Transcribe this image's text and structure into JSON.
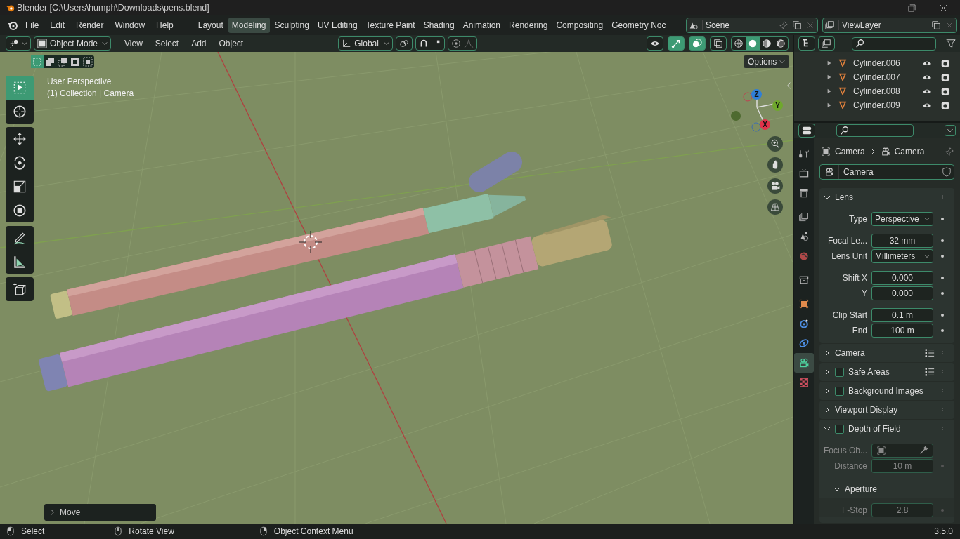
{
  "window": {
    "title": "Blender [C:\\Users\\humph\\Downloads\\pens.blend]"
  },
  "menu": [
    "File",
    "Edit",
    "Render",
    "Window",
    "Help"
  ],
  "workspaces": [
    {
      "label": "Layout",
      "selected": false
    },
    {
      "label": "Modeling",
      "selected": true
    },
    {
      "label": "Sculpting",
      "selected": false
    },
    {
      "label": "UV Editing",
      "selected": false
    },
    {
      "label": "Texture Paint",
      "selected": false
    },
    {
      "label": "Shading",
      "selected": false
    },
    {
      "label": "Animation",
      "selected": false
    },
    {
      "label": "Rendering",
      "selected": false
    },
    {
      "label": "Compositing",
      "selected": false
    },
    {
      "label": "Geometry Noc",
      "selected": false
    }
  ],
  "scene": {
    "name": "Scene"
  },
  "view_layer": {
    "name": "ViewLayer"
  },
  "viewport": {
    "mode": "Object Mode",
    "menus": [
      "View",
      "Select",
      "Add",
      "Object"
    ],
    "orientation": "Global",
    "proportional_editing": {
      "on": false
    },
    "shading": [
      {
        "kind": "wireframe",
        "selected": false
      },
      {
        "kind": "solid",
        "selected": true
      },
      {
        "kind": "material",
        "selected": false
      },
      {
        "kind": "rendered",
        "selected": false
      }
    ],
    "select_modes": [
      {
        "kind": "new",
        "selected": true
      },
      {
        "kind": "extend",
        "selected": false
      },
      {
        "kind": "subtract",
        "selected": false
      },
      {
        "kind": "invert",
        "selected": false
      },
      {
        "kind": "intersect",
        "selected": false
      }
    ],
    "options": "Options",
    "info": [
      "User Perspective",
      "(1) Collection | Camera"
    ],
    "tools": [
      {
        "kind": "select",
        "selected": true
      },
      {
        "kind": "cursor",
        "selected": false
      },
      {
        "kind": "move",
        "selected": false
      },
      {
        "kind": "rotate",
        "selected": false
      },
      {
        "kind": "scale",
        "selected": false
      },
      {
        "kind": "transform",
        "selected": false
      },
      {
        "kind": "annotate",
        "selected": false
      },
      {
        "kind": "measure",
        "selected": false
      },
      {
        "kind": "add_cube",
        "selected": false
      }
    ],
    "gizmo_axes": [
      {
        "label": "Z",
        "color": "#2f7fd8"
      },
      {
        "label": "Y",
        "color": "#6fa82c"
      },
      {
        "label": "X",
        "color": "#e0334a"
      }
    ],
    "last_operator": "Move"
  },
  "outliner": {
    "items": [
      {
        "name": "Cylinder.006"
      },
      {
        "name": "Cylinder.007"
      },
      {
        "name": "Cylinder.008"
      },
      {
        "name": "Cylinder.009"
      }
    ]
  },
  "properties": {
    "tabs": [
      {
        "kind": "tool",
        "selected": false
      },
      {
        "kind": "render",
        "selected": false
      },
      {
        "kind": "output",
        "selected": false
      },
      {
        "kind": "view_layer",
        "selected": false
      },
      {
        "kind": "scene",
        "selected": false
      },
      {
        "kind": "world",
        "selected": false
      },
      {
        "kind": "collection",
        "selected": false
      },
      {
        "kind": "object",
        "selected": false
      },
      {
        "kind": "physics",
        "selected": false
      },
      {
        "kind": "constraints",
        "selected": false
      },
      {
        "kind": "camera",
        "selected": true
      },
      {
        "kind": "texture",
        "selected": false
      }
    ],
    "breadcrumb": [
      "Camera",
      "Camera"
    ],
    "datablock": "Camera",
    "panels": [
      {
        "title": "Lens",
        "expanded": true,
        "groups": [
          {
            "fields": [
              {
                "label": "Type",
                "value": "Perspective",
                "kind": "dropdown",
                "disabled": false
              }
            ]
          },
          {
            "fields": [
              {
                "label": "Focal Le...",
                "value": "32 mm",
                "kind": "number",
                "disabled": false
              },
              {
                "label": "Lens Unit",
                "value": "Millimeters",
                "kind": "dropdown",
                "disabled": false
              }
            ]
          },
          {
            "fields": [
              {
                "label": "Shift X",
                "value": "0.000",
                "kind": "number",
                "disabled": false
              },
              {
                "label": "Y",
                "value": "0.000",
                "kind": "number",
                "disabled": false
              }
            ]
          },
          {
            "fields": [
              {
                "label": "Clip Start",
                "value": "0.1 m",
                "kind": "number",
                "disabled": false
              },
              {
                "label": "End",
                "value": "100 m",
                "kind": "number",
                "disabled": false
              }
            ]
          }
        ]
      },
      {
        "title": "Camera",
        "expanded": false,
        "presets": true
      },
      {
        "title": "Safe Areas",
        "expanded": false,
        "presets": true,
        "checkbox": {
          "checked": false
        }
      },
      {
        "title": "Background Images",
        "expanded": false,
        "checkbox": {
          "checked": false
        }
      },
      {
        "title": "Viewport Display",
        "expanded": false
      },
      {
        "title": "Depth of Field",
        "expanded": true,
        "checkbox": {
          "checked": false
        },
        "groups": [
          {
            "fields": [
              {
                "label": "Focus Ob...",
                "kind": "object",
                "disabled": true
              },
              {
                "label": "Distance",
                "value": "10 m",
                "kind": "number",
                "disabled": true
              }
            ]
          }
        ],
        "subpanel": {
          "title": "Aperture",
          "expanded": true,
          "fields": [
            {
              "label": "F-Stop",
              "value": "2.8",
              "kind": "number",
              "disabled": true
            }
          ]
        }
      }
    ]
  },
  "status_bar": {
    "hints": [
      {
        "kind": "left",
        "text": "Select"
      },
      {
        "kind": "middle",
        "text": "Rotate View"
      },
      {
        "kind": "right",
        "text": "Object Context Menu"
      }
    ],
    "version": "3.5.0"
  }
}
